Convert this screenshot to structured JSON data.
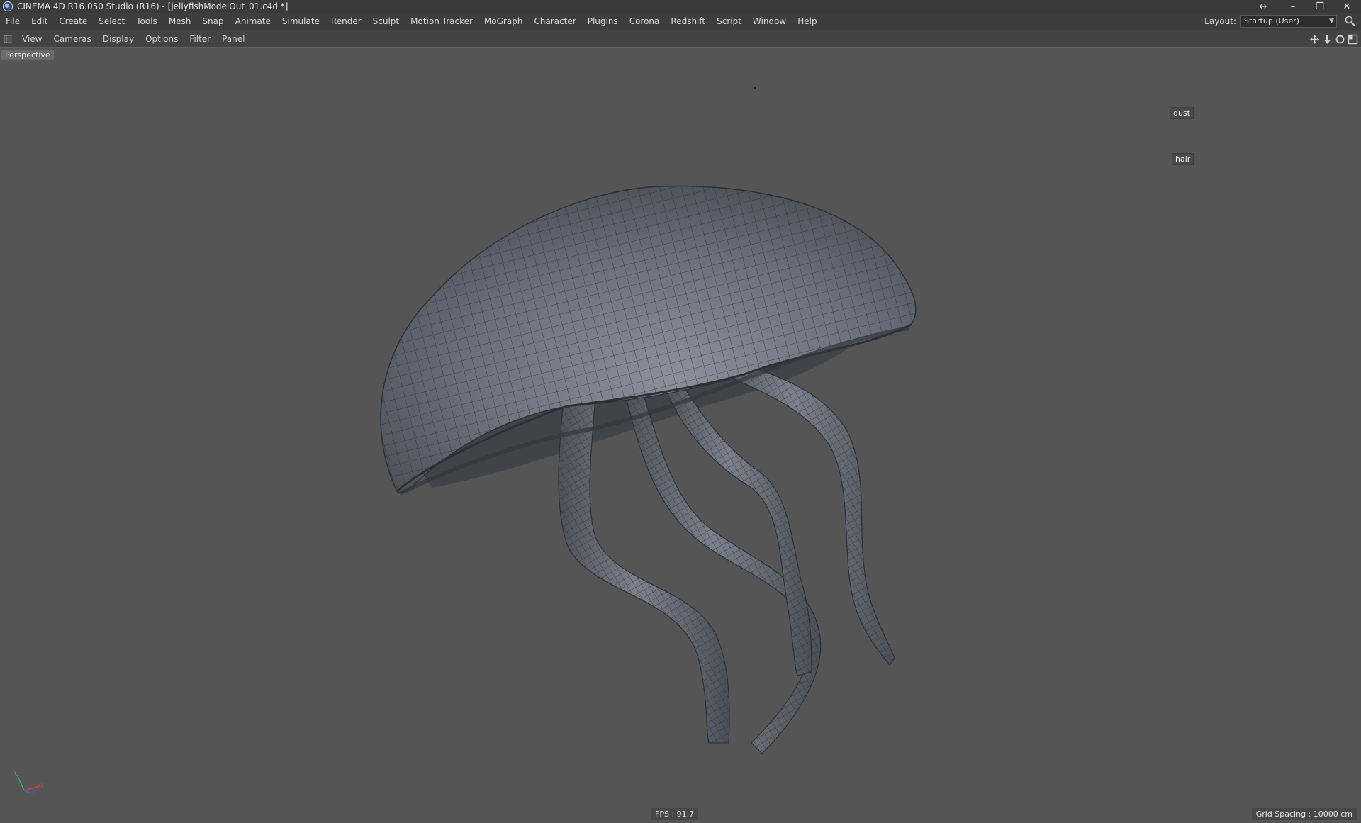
{
  "window": {
    "title": "CINEMA 4D R16.050 Studio (R16) - [jellyfishModelOut_01.c4d *]",
    "controls": [
      "↔",
      "–",
      "❐",
      "✕"
    ]
  },
  "menu": [
    "File",
    "Edit",
    "Create",
    "Select",
    "Tools",
    "Mesh",
    "Snap",
    "Animate",
    "Simulate",
    "Render",
    "Sculpt",
    "Motion Tracker",
    "MoGraph",
    "Character",
    "Plugins",
    "Corona",
    "Redshift",
    "Script",
    "Window",
    "Help"
  ],
  "layout": {
    "label": "Layout:",
    "value": "Startup (User)"
  },
  "viewport_menu": [
    "View",
    "Cameras",
    "Display",
    "Options",
    "Filter",
    "Panel"
  ],
  "viewport": {
    "camera_label": "Perspective",
    "tags": [
      "dust",
      "hair"
    ],
    "fps": "FPS : 91.7",
    "grid_spacing": "Grid Spacing : 10000 cm"
  },
  "colors": {
    "background": "#555555",
    "menubar": "#3d3d3d",
    "mesh": "#6c7480",
    "wire": "#2a2e35"
  },
  "icons": [
    "app-icon",
    "grip-icon",
    "search-icon",
    "move-icon",
    "pan-icon",
    "rotate-icon",
    "maximize-icon",
    "axis-gizmo-icon"
  ]
}
